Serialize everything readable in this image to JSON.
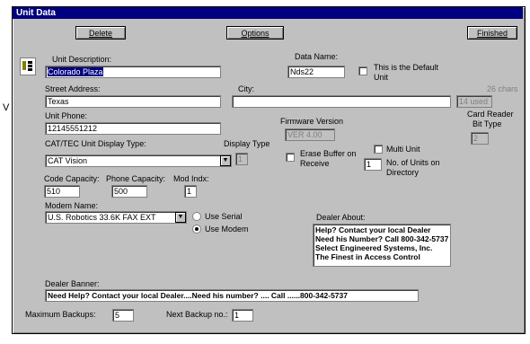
{
  "window": {
    "title": "Unit Data"
  },
  "toolbar": {
    "delete": "Delete",
    "options": "Options",
    "finished": "Finished"
  },
  "stray_text": "V",
  "unit_description": {
    "label": "Unit Description:",
    "value": "Colorado Plaza"
  },
  "data_name": {
    "label": "Data Name:",
    "value": "Nds22"
  },
  "default_unit": {
    "label_line1": "This is the Default",
    "label_line2": "Unit"
  },
  "street_address": {
    "label": "Street Address:",
    "value": "Texas"
  },
  "city": {
    "label": "City:",
    "value": ""
  },
  "chars": {
    "label": "26 chars",
    "value": "14 used"
  },
  "unit_phone": {
    "label": "Unit Phone:",
    "value": "12145551212"
  },
  "firmware": {
    "label": "Firmware Version",
    "value": "VER 4.00"
  },
  "card_reader": {
    "label_line1": "Card Reader",
    "label_line2": "Bit Type",
    "value": "2"
  },
  "display_type_label": "CAT/TEC Unit Display Type:",
  "display_type_select": "CAT Vision",
  "display_type": {
    "label": "Display Type",
    "value": "1"
  },
  "erase_buffer": {
    "label_line1": "Erase Buffer on",
    "label_line2": "Receive"
  },
  "multi_unit": {
    "label": "Multi Unit"
  },
  "num_units": {
    "value": "1",
    "label_line1": "No. of Units on",
    "label_line2": "Directory"
  },
  "code_capacity": {
    "label": "Code Capacity:",
    "value": "510"
  },
  "phone_capacity": {
    "label": "Phone Capacity:",
    "value": "500"
  },
  "mod_indx": {
    "label": "Mod Indx:",
    "value": "1"
  },
  "modem_name": {
    "label": "Modem Name:",
    "value": "U.S. Robotics 33.6K FAX EXT"
  },
  "use_serial": {
    "label": "Use Serial"
  },
  "use_modem": {
    "label": "Use Modem"
  },
  "dealer_about": {
    "label": "Dealer About:",
    "lines": [
      "Help? Contact your local Dealer",
      "Need his Number? Call 800-342-5737",
      "Select Engineered Systems, Inc.",
      "The Finest in Access Control"
    ]
  },
  "dealer_banner": {
    "label": "Dealer Banner:",
    "value": "Need Help? Contact your local Dealer....Need his number? .... Call ......800-342-5737"
  },
  "max_backups": {
    "label": "Maximum Backups:",
    "value": "5"
  },
  "next_backup": {
    "label": "Next Backup no.:",
    "value": "1"
  },
  "colors": {
    "title_bar": "#000080",
    "face": "#c0c0c0",
    "selection": "#000080"
  }
}
